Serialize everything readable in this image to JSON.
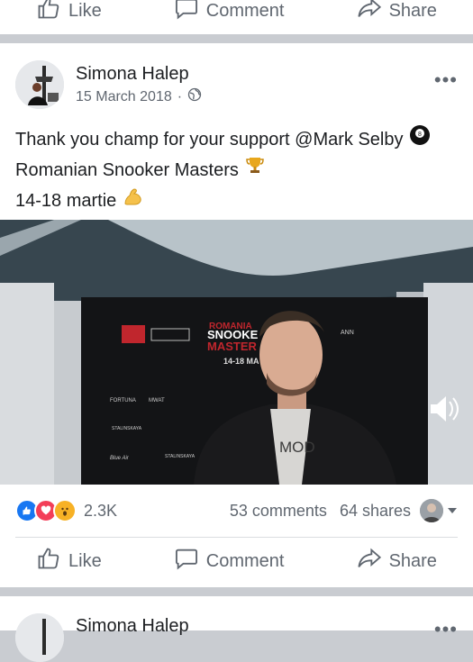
{
  "top_actions": {
    "like": "Like",
    "comment": "Comment",
    "share": "Share"
  },
  "post": {
    "author": "Simona  Halep",
    "date": "15 March 2018",
    "separator": "·",
    "lines": [
      "Thank you champ for your support @Mark Selby",
      "Romanian Snooker Masters",
      "14-18 martie"
    ],
    "video": {
      "banner_title_1": "ROMANIA",
      "banner_title_2": "SNOOKE",
      "banner_title_3": "MASTER",
      "banner_dates": "14-18 MA",
      "sponsor_1": "FORTUNA",
      "sponsor_2": "MWAT",
      "sponsor_3": "STALINSKAYA",
      "sponsor_4": "Blue Air",
      "sponsor_5": "STALINSKAYA",
      "sponsor_6": "ANN",
      "shirt_text": "MOD"
    },
    "stats": {
      "reactions": "2.3K",
      "comments": "53 comments",
      "shares": "64 shares"
    },
    "actions": {
      "like": "Like",
      "comment": "Comment",
      "share": "Share"
    }
  },
  "next_post": {
    "author": "Simona  Halep"
  },
  "colors": {
    "like_blue": "#1877f2",
    "love_red": "#f33e58",
    "wow_yellow": "#f7b125",
    "divider": "#c9ccd1"
  }
}
